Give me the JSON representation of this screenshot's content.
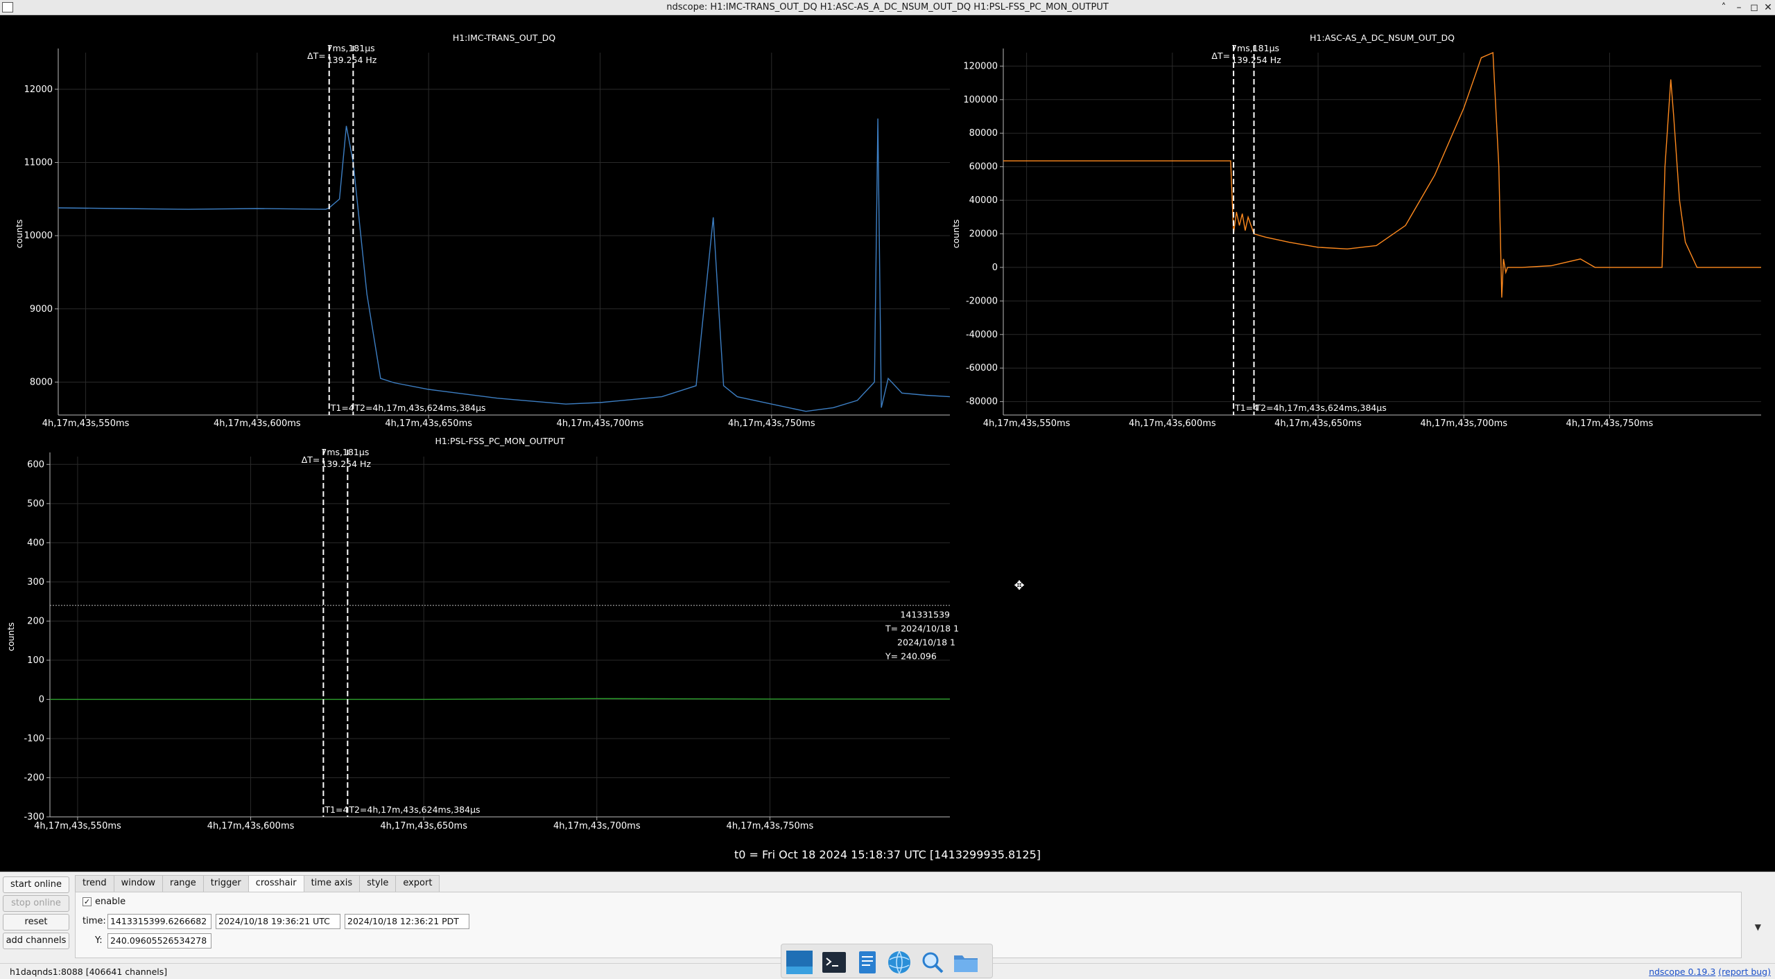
{
  "window": {
    "title": "ndscope: H1:IMC-TRANS_OUT_DQ H1:ASC-AS_A_DC_NSUM_OUT_DQ H1:PSL-FSS_PC_MON_OUTPUT",
    "minimize_icon": "chevron-up-icon",
    "maximize_icon": "minimize-icon",
    "restore_icon": "maximize-icon",
    "close_icon": "close-icon"
  },
  "colors": {
    "imc": "#3d7fc4",
    "asc": "#ff8a1e",
    "psl": "#2ca02c",
    "cursor": "#ffffff",
    "background": "#000000"
  },
  "plots": [
    {
      "title": "H1:IMC-TRANS_OUT_DQ",
      "ylabel": "counts",
      "yticks": [
        "12000",
        "11000",
        "10000",
        "9000",
        "8000"
      ],
      "xticks": [
        "4h,17m,43s,550ms",
        "4h,17m,43s,600ms",
        "4h,17m,43s,650ms",
        "4h,17m,43s,700ms",
        "4h,17m,43s,750ms"
      ],
      "delta_label": "ΔT=",
      "delta_time": "7ms,181µs",
      "delta_freq": "139.254 Hz",
      "t1_label": "T1=4",
      "t2_label": "T2=4h,17m,43s,624ms,384µs"
    },
    {
      "title": "H1:ASC-AS_A_DC_NSUM_OUT_DQ",
      "ylabel": "counts",
      "yticks": [
        "120000",
        "100000",
        "80000",
        "60000",
        "40000",
        "20000",
        "0",
        "-20000",
        "-40000",
        "-60000",
        "-80000"
      ],
      "xticks": [
        "4h,17m,43s,550ms",
        "4h,17m,43s,600ms",
        "4h,17m,43s,650ms",
        "4h,17m,43s,700ms",
        "4h,17m,43s,750ms"
      ],
      "delta_label": "ΔT=",
      "delta_time": "7ms,181µs",
      "delta_freq": "139.254 Hz",
      "t1_label": "T1=4",
      "t2_label": "T2=4h,17m,43s,624ms,384µs"
    },
    {
      "title": "H1:PSL-FSS_PC_MON_OUTPUT",
      "ylabel": "counts",
      "yticks": [
        "600",
        "500",
        "400",
        "300",
        "200",
        "100",
        "0",
        "-100",
        "-200",
        "-300"
      ],
      "xticks": [
        "4h,17m,43s,550ms",
        "4h,17m,43s,600ms",
        "4h,17m,43s,650ms",
        "4h,17m,43s,700ms",
        "4h,17m,43s,750ms"
      ],
      "delta_label": "ΔT=",
      "delta_time": "7ms,181µs",
      "delta_freq": "139.254 Hz",
      "t1_label": "T1=4",
      "t2_label": "T2=4h,17m,43s,624ms,384µs",
      "crosshair_gps": "141331539",
      "crosshair_t_label": "T= 2024/10/18 1",
      "crosshair_t2": "2024/10/18 1",
      "crosshair_y_label": "Y= 240.096"
    }
  ],
  "t0_label": "t0 = Fri Oct 18 2024 15:18:37 UTC [1413299935.8125]",
  "chart_data": [
    {
      "type": "line",
      "title": "H1:IMC-TRANS_OUT_DQ",
      "ylabel": "counts",
      "xlim_ms": [
        542,
        802
      ],
      "ylim": [
        7550,
        12500
      ],
      "cursors_ms": [
        621,
        628
      ],
      "series": [
        {
          "x": [
            542,
            560,
            580,
            600,
            620,
            621,
            624,
            626,
            628,
            632,
            636,
            640,
            650,
            670,
            690,
            700,
            718,
            728,
            733,
            735,
            736,
            740,
            750,
            760,
            768,
            775,
            780,
            781,
            782,
            784,
            788,
            795,
            802
          ],
          "values": [
            10380,
            10370,
            10360,
            10370,
            10360,
            10380,
            10500,
            11500,
            11000,
            9200,
            8050,
            7990,
            7900,
            7780,
            7700,
            7720,
            7800,
            7950,
            10250,
            8700,
            7950,
            7800,
            7700,
            7600,
            7650,
            7750,
            8000,
            11600,
            7650,
            8050,
            7850,
            7820,
            7800
          ]
        }
      ]
    },
    {
      "type": "line",
      "title": "H1:ASC-AS_A_DC_NSUM_OUT_DQ",
      "ylabel": "counts",
      "xlim_ms": [
        542,
        802
      ],
      "ylim": [
        -88000,
        128000
      ],
      "cursors_ms": [
        621,
        628
      ],
      "series": [
        {
          "x": [
            542,
            560,
            580,
            600,
            620,
            621,
            622,
            623,
            624,
            625,
            626,
            628,
            632,
            640,
            650,
            660,
            670,
            680,
            690,
            700,
            706,
            710,
            712,
            713,
            713.6,
            714.4,
            715,
            720,
            730,
            740,
            745,
            752,
            760,
            768,
            769,
            771,
            772,
            774,
            776,
            780,
            784,
            790,
            802
          ],
          "values": [
            63500,
            63500,
            63500,
            63500,
            63500,
            20000,
            33000,
            25000,
            32000,
            22000,
            30000,
            20000,
            18000,
            15000,
            12000,
            11000,
            13000,
            25000,
            55000,
            95000,
            125000,
            128000,
            60000,
            -18000,
            5000,
            -3000,
            0,
            0,
            1000,
            5000,
            0,
            0,
            0,
            0,
            60000,
            112000,
            90000,
            40000,
            15000,
            0,
            0,
            0,
            0
          ]
        }
      ]
    },
    {
      "type": "line",
      "title": "H1:PSL-FSS_PC_MON_OUTPUT",
      "ylabel": "counts",
      "xlim_ms": [
        542,
        802
      ],
      "ylim": [
        -300,
        620
      ],
      "cursors_ms": [
        621,
        628
      ],
      "crosshair_y": 240.096,
      "series": [
        {
          "x": [
            542,
            600,
            650,
            700,
            750,
            802
          ],
          "values": [
            0,
            0,
            0,
            2,
            1,
            1
          ]
        }
      ]
    }
  ],
  "controls": {
    "start_online": "start online",
    "stop_online": "stop online",
    "reset": "reset",
    "add_channels": "add channels",
    "tabs": [
      "trend",
      "window",
      "range",
      "trigger",
      "crosshair",
      "time axis",
      "style",
      "export"
    ],
    "active_tab": "crosshair",
    "enable_label": "enable",
    "enable_checked": "✓",
    "time_label": "time:",
    "time_gps": "1413315399.6266682",
    "time_utc": "2024/10/18 19:36:21 UTC",
    "time_pdt": "2024/10/18 12:36:21 PDT",
    "y_label": "Y:",
    "y_value": "240.09605526534278",
    "dropdown_icon": "triangle-down-icon"
  },
  "status": {
    "connection": "h1daqnds1:8088  [406641 channels]",
    "app_version": "ndscope 0.19.3",
    "report_bug": "(report bug)"
  },
  "taskbar": {
    "items": [
      "desktop-icon",
      "terminal-icon",
      "text-editor-icon",
      "browser-icon",
      "search-icon",
      "folder-icon"
    ]
  }
}
